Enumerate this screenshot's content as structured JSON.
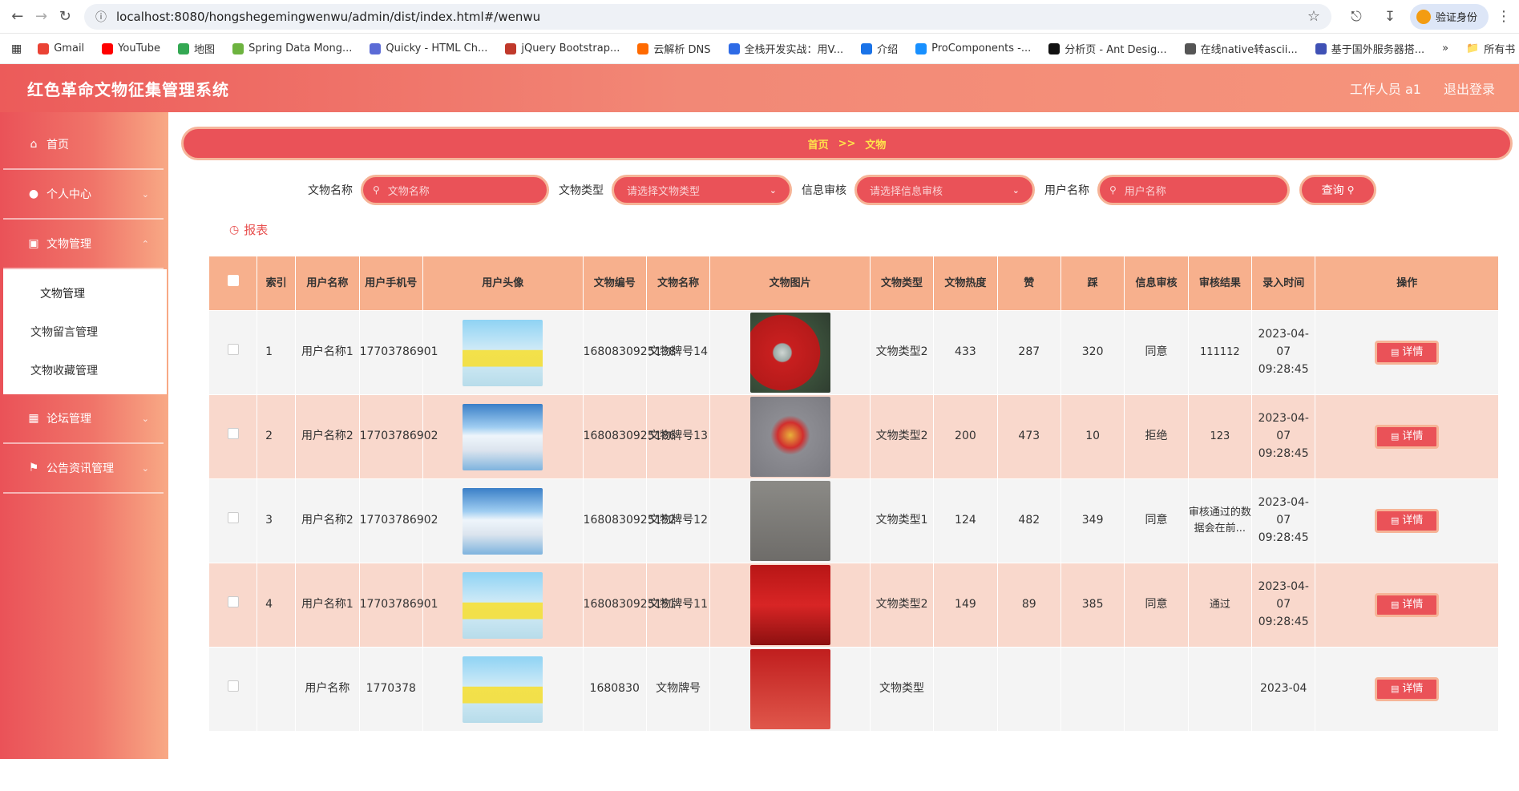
{
  "browser": {
    "url": "localhost:8080/hongshegemingwenwu/admin/dist/index.html#/wenwu",
    "verify_label": "验证身份",
    "bookmarks": [
      {
        "label": "Gmail",
        "color": "#ea4335"
      },
      {
        "label": "YouTube",
        "color": "#ff0000"
      },
      {
        "label": "地图",
        "color": "#34a853"
      },
      {
        "label": "Spring Data Mong...",
        "color": "#6db33f"
      },
      {
        "label": "Quicky - HTML Ch...",
        "color": "#5b6bd6"
      },
      {
        "label": "jQuery Bootstrap...",
        "color": "#c0392b"
      },
      {
        "label": "云解析 DNS",
        "color": "#ff6a00"
      },
      {
        "label": "全栈开发实战：用V...",
        "color": "#2e6be6"
      },
      {
        "label": "介绍",
        "color": "#1a73e8"
      },
      {
        "label": "ProComponents -...",
        "color": "#1890ff"
      },
      {
        "label": "分析页 - Ant Desig...",
        "color": "#111111"
      },
      {
        "label": "在线native转ascii...",
        "color": "#555555"
      },
      {
        "label": "基于国外服务器搭...",
        "color": "#3f51b5"
      }
    ],
    "bookmarks_all": "所有书"
  },
  "app": {
    "title": "红色革命文物征集管理系统",
    "user_label": "工作人员 a1",
    "logout_label": "退出登录"
  },
  "sidebar": {
    "home": "首页",
    "personal": "个人中心",
    "relic_mgmt": "文物管理",
    "sub_items": [
      "文物管理",
      "文物留言管理",
      "文物收藏管理"
    ],
    "forum": "论坛管理",
    "notice": "公告资讯管理"
  },
  "breadcrumb": {
    "home": "首页",
    "sep": ">>",
    "current": "文物"
  },
  "filters": {
    "name_label": "文物名称",
    "name_placeholder": "文物名称",
    "type_label": "文物类型",
    "type_placeholder": "请选择文物类型",
    "audit_label": "信息审核",
    "audit_placeholder": "请选择信息审核",
    "user_label": "用户名称",
    "user_placeholder": "用户名称",
    "query_label": "查询"
  },
  "report_label": "报表",
  "table": {
    "headers": [
      "索引",
      "用户名称",
      "用户手机号",
      "用户头像",
      "文物编号",
      "文物名称",
      "文物图片",
      "文物类型",
      "文物热度",
      "赞",
      "踩",
      "信息审核",
      "审核结果",
      "录入时间",
      "操作"
    ],
    "detail_label": "详情",
    "rows": [
      {
        "idx": "1",
        "user": "用户名称1",
        "phone": "17703786901",
        "avatar": "girl",
        "code": "1680830925138",
        "name": "文物牌号14",
        "img": "rel1",
        "type": "文物类型2",
        "heat": "433",
        "up": "287",
        "down": "320",
        "audit": "同意",
        "result": "111112",
        "time": "2023-04-07 09:28:45"
      },
      {
        "idx": "2",
        "user": "用户名称2",
        "phone": "17703786902",
        "avatar": "boy",
        "code": "1680830925186",
        "name": "文物牌号13",
        "img": "rel2",
        "type": "文物类型2",
        "heat": "200",
        "up": "473",
        "down": "10",
        "audit": "拒绝",
        "result": "123",
        "time": "2023-04-07 09:28:45"
      },
      {
        "idx": "3",
        "user": "用户名称2",
        "phone": "17703786902",
        "avatar": "boy",
        "code": "1680830925152",
        "name": "文物牌号12",
        "img": "rel3",
        "type": "文物类型1",
        "heat": "124",
        "up": "482",
        "down": "349",
        "audit": "同意",
        "result": "审核通过的数据会在前...",
        "time": "2023-04-07 09:28:45"
      },
      {
        "idx": "4",
        "user": "用户名称1",
        "phone": "17703786901",
        "avatar": "girl",
        "code": "1680830925151",
        "name": "文物牌号11",
        "img": "rel4",
        "type": "文物类型2",
        "heat": "149",
        "up": "89",
        "down": "385",
        "audit": "同意",
        "result": "通过",
        "time": "2023-04-07 09:28:45"
      },
      {
        "idx": "",
        "user": "用户名称",
        "phone": "1770378",
        "avatar": "girl",
        "code": "1680830",
        "name": "文物牌号",
        "img": "rel5",
        "type": "文物类型",
        "heat": "",
        "up": "",
        "down": "",
        "audit": "",
        "result": "",
        "time": "2023-04"
      }
    ]
  }
}
